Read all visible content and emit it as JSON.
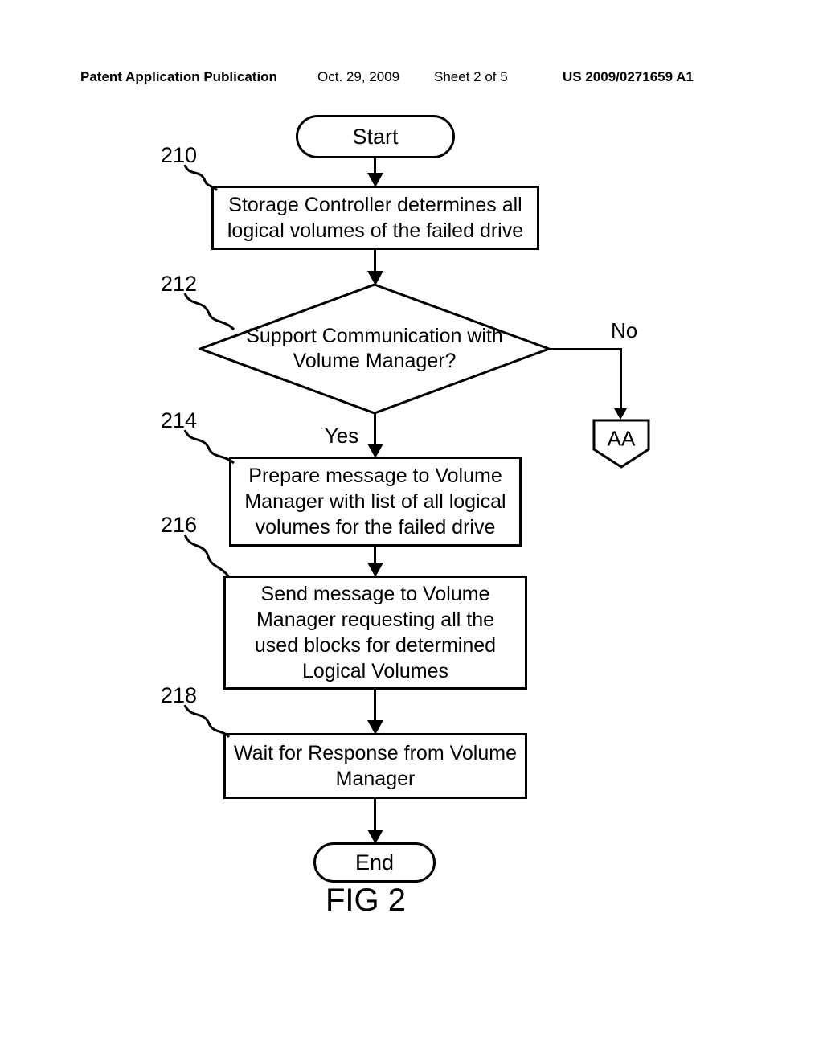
{
  "header": {
    "pub_label": "Patent Application Publication",
    "pub_date": "Oct. 29, 2009",
    "sheet_label": "Sheet 2 of 5",
    "pub_number": "US 2009/0271659 A1"
  },
  "flow": {
    "start": "Start",
    "end": "End",
    "box_210": "Storage Controller determines all logical volumes of the failed drive",
    "decision_212": "Support Communication with Volume Manager?",
    "yes": "Yes",
    "no": "No",
    "offpage": "AA",
    "box_214": "Prepare message to Volume Manager with list of all logical volumes for the failed drive",
    "box_216": "Send message to Volume Manager requesting all the used blocks for determined Logical Volumes",
    "box_218": "Wait for Response from Volume Manager"
  },
  "refs": {
    "r210": "210",
    "r212": "212",
    "r214": "214",
    "r216": "216",
    "r218": "218"
  },
  "figure_label": "FIG 2"
}
